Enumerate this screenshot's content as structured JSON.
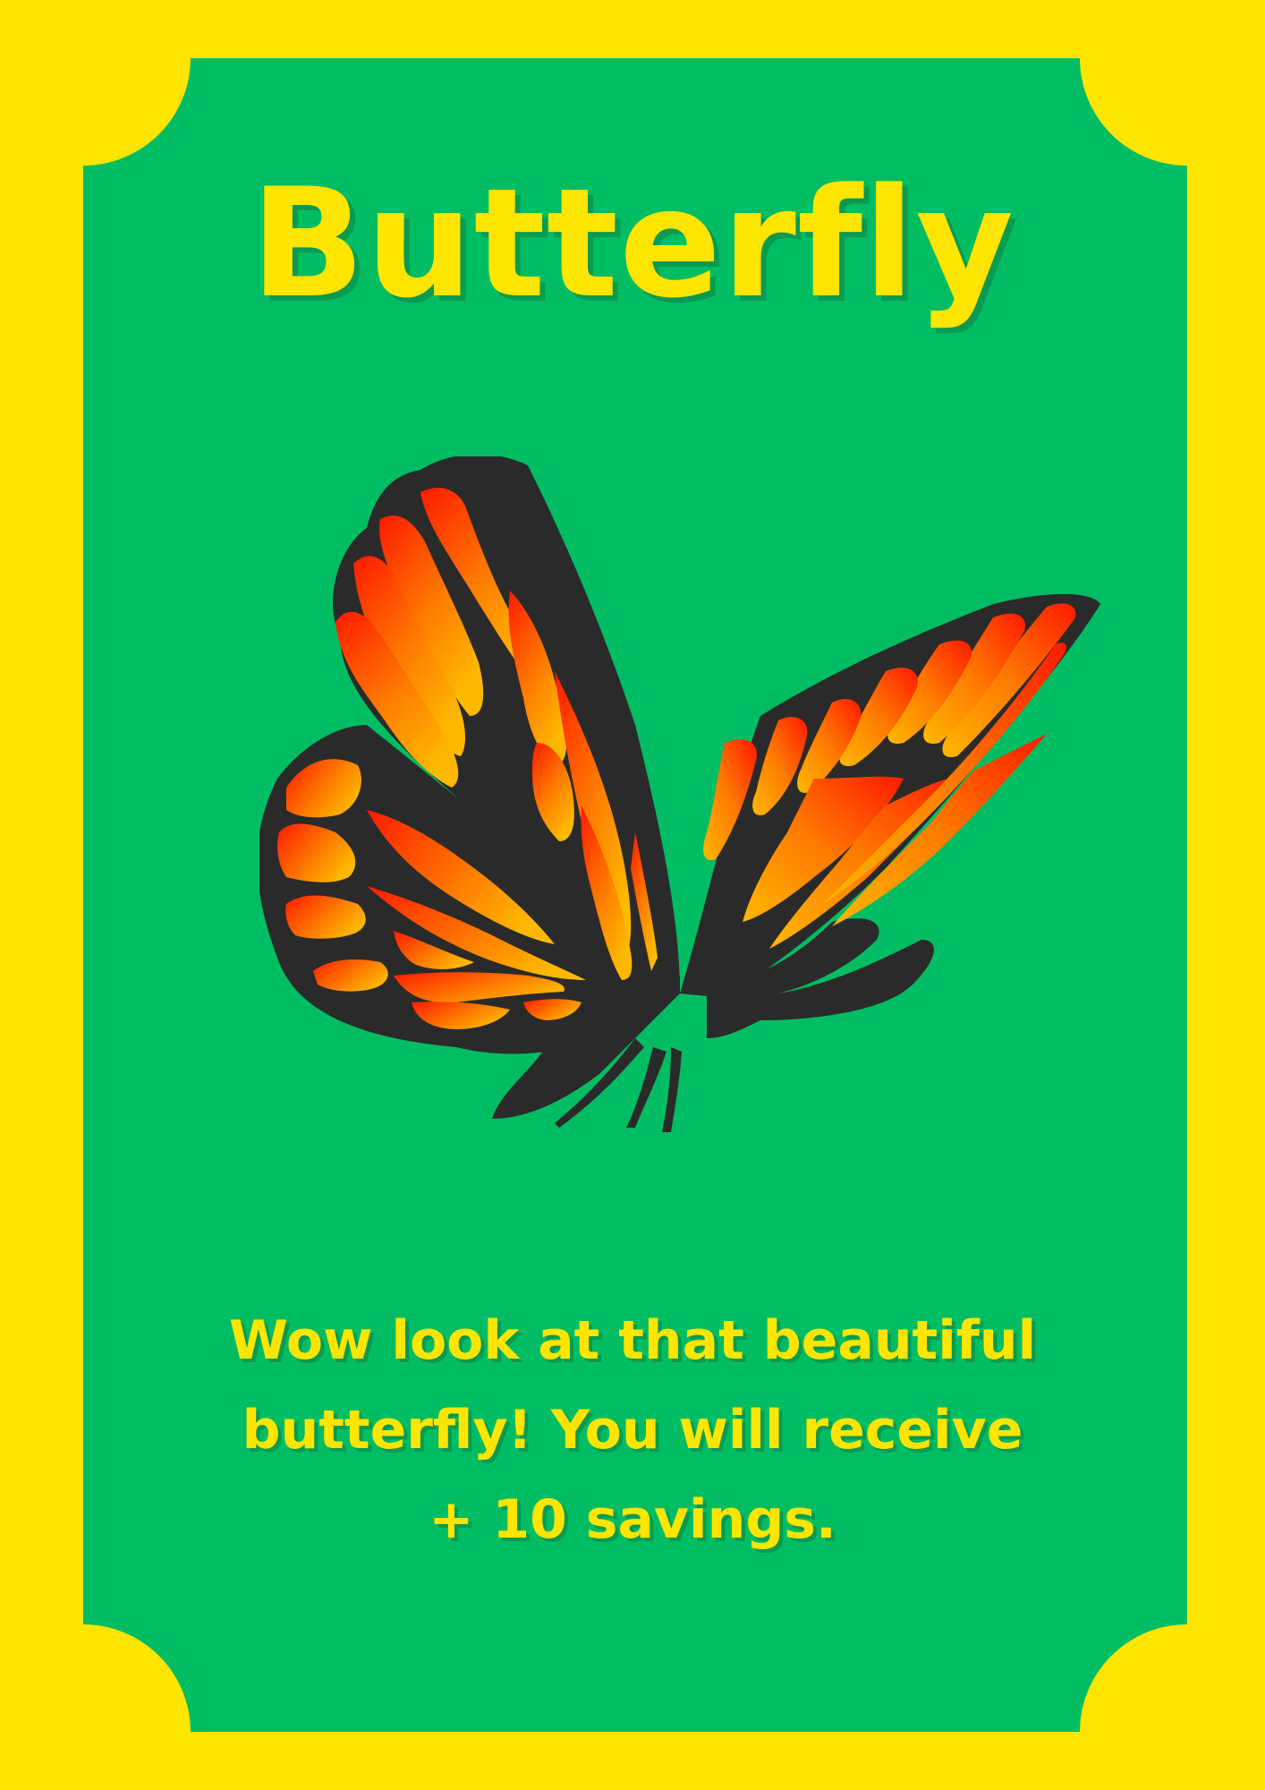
{
  "card": {
    "title": "Butterfly",
    "message_line1": "Wow look at that beautiful",
    "message_line2": "butterfly! You will receive",
    "message_line3": "+ 10 savings."
  },
  "colors": {
    "background": "#FFE500",
    "card": "#00BD63",
    "text": "#FFE500",
    "wing_outline": "#2A2A2A",
    "wing_red": "#FF1A00",
    "wing_orange": "#FF7A00",
    "wing_yellow": "#FFB800"
  },
  "illustration": "butterfly-icon"
}
